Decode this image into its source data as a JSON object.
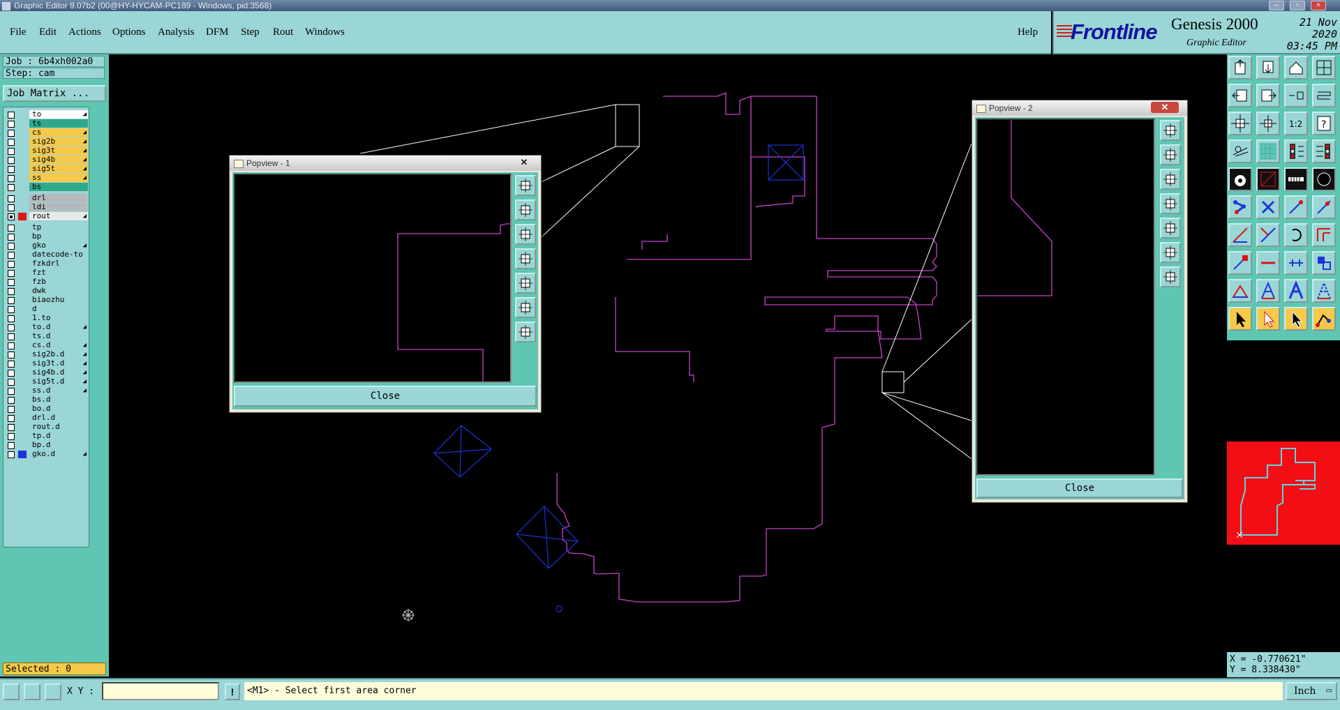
{
  "window": {
    "title": "Graphic Editor 9.07b2 (00@HY-HYCAM-PC189 - Windows, pid:3568)"
  },
  "menu": [
    {
      "label": "File"
    },
    {
      "label": "Edit"
    },
    {
      "label": "Actions"
    },
    {
      "label": "Options"
    },
    {
      "label": "Analysis"
    },
    {
      "label": "DFM"
    },
    {
      "label": "Step"
    },
    {
      "label": "Rout"
    },
    {
      "label": "Windows"
    },
    {
      "label": "Help"
    }
  ],
  "brand": {
    "logo": "Frontline",
    "product": "Genesis 2000",
    "subtitle": "Graphic Editor",
    "date": "21 Nov 2020",
    "time": "03:45 PM"
  },
  "job": {
    "label": "Job : 6b4xh002a0",
    "step": "Step: cam",
    "matrix_button": "Job Matrix ..."
  },
  "layers": [
    {
      "name": "to",
      "bg": "#ffffff",
      "mark": true
    },
    {
      "name": "ts",
      "bg": "#2fa98a"
    },
    {
      "name": "cs",
      "bg": "#f6c94a",
      "mark": true
    },
    {
      "name": "sig2b",
      "bg": "#f6c94a",
      "mark": true
    },
    {
      "name": "sig3t",
      "bg": "#f6c94a",
      "mark": true
    },
    {
      "name": "sig4b",
      "bg": "#f6c94a",
      "mark": true
    },
    {
      "name": "sig5t",
      "bg": "#f6c94a",
      "mark": true
    },
    {
      "name": "ss",
      "bg": "#f6c94a",
      "mark": true
    },
    {
      "name": "bs",
      "bg": "#2fa98a"
    },
    {
      "name": "drl",
      "bg": "#b4b9be",
      "gap": true
    },
    {
      "name": "ldi",
      "bg": "#b4b9be"
    },
    {
      "name": "rout",
      "bg": "#e9e9e9",
      "color": "#e41414",
      "checked": true,
      "mark": true
    },
    {
      "name": "tp",
      "bg": "#9ad6d6",
      "gap": true
    },
    {
      "name": "bp",
      "bg": "#9ad6d6"
    },
    {
      "name": "gko",
      "bg": "#9ad6d6",
      "mark": true
    },
    {
      "name": "datecode-to",
      "bg": "#9ad6d6"
    },
    {
      "name": "fzkdrl",
      "bg": "#9ad6d6"
    },
    {
      "name": "fzt",
      "bg": "#9ad6d6"
    },
    {
      "name": "fzb",
      "bg": "#9ad6d6"
    },
    {
      "name": "dwk",
      "bg": "#9ad6d6"
    },
    {
      "name": "biaozhu",
      "bg": "#9ad6d6"
    },
    {
      "name": "d",
      "bg": "#9ad6d6"
    },
    {
      "name": "1.to",
      "bg": "#9ad6d6"
    },
    {
      "name": "to.d",
      "bg": "#9ad6d6",
      "mark": true
    },
    {
      "name": "ts.d",
      "bg": "#9ad6d6"
    },
    {
      "name": "cs.d",
      "bg": "#9ad6d6",
      "mark": true
    },
    {
      "name": "sig2b.d",
      "bg": "#9ad6d6",
      "mark": true
    },
    {
      "name": "sig3t.d",
      "bg": "#9ad6d6",
      "mark": true
    },
    {
      "name": "sig4b.d",
      "bg": "#9ad6d6",
      "mark": true
    },
    {
      "name": "sig5t.d",
      "bg": "#9ad6d6",
      "mark": true
    },
    {
      "name": "ss.d",
      "bg": "#9ad6d6",
      "mark": true
    },
    {
      "name": "bs.d",
      "bg": "#9ad6d6"
    },
    {
      "name": "bo.d",
      "bg": "#9ad6d6"
    },
    {
      "name": "drl.d",
      "bg": "#9ad6d6"
    },
    {
      "name": "rout.d",
      "bg": "#9ad6d6"
    },
    {
      "name": "tp.d",
      "bg": "#9ad6d6"
    },
    {
      "name": "bp.d",
      "bg": "#9ad6d6"
    },
    {
      "name": "gko.d",
      "bg": "#9ad6d6",
      "color": "#1f33d9",
      "mark": true
    }
  ],
  "status": {
    "selected": "Selected : 0"
  },
  "coords": {
    "x": "X = -0.770621\"",
    "y": "Y = 8.338430\""
  },
  "bottom": {
    "xy_label": "X Y :",
    "xy_value": "",
    "prompt_icon": "!",
    "prompt": "<M1> - Select first area corner",
    "units": "Inch"
  },
  "popview1": {
    "title": "Popview - 1",
    "close": "Close"
  },
  "popview2": {
    "title": "Popview - 2",
    "close": "Close"
  },
  "colors": {
    "panel": "#9ad6d6",
    "teal": "#5fc6b3",
    "outline": "#c844c8",
    "yellow": "#f6c94a",
    "red": "#f30d14"
  },
  "tools": [
    {
      "icon": "save-up-icon"
    },
    {
      "icon": "save-down-icon"
    },
    {
      "icon": "home-icon"
    },
    {
      "icon": "window-split-icon"
    },
    {
      "icon": "pan-left-icon"
    },
    {
      "icon": "pan-right-icon"
    },
    {
      "icon": "snap-icon"
    },
    {
      "icon": "flow-icon"
    },
    {
      "icon": "zoom-fit-icon"
    },
    {
      "icon": "zoom-center-icon"
    },
    {
      "icon": "one-to-two-icon"
    },
    {
      "icon": "help-icon"
    },
    {
      "icon": "measure-icon"
    },
    {
      "icon": "grid-icon"
    },
    {
      "icon": "traffic-light-icon"
    },
    {
      "icon": "traffic-light-2-icon"
    },
    {
      "icon": "pad-icon"
    },
    {
      "icon": "line-red-icon"
    },
    {
      "icon": "ruler-icon"
    },
    {
      "icon": "circle-icon"
    },
    {
      "icon": "node-icon"
    },
    {
      "icon": "cross-node-icon"
    },
    {
      "icon": "node-red-icon"
    },
    {
      "icon": "node-red-2-icon"
    },
    {
      "icon": "draw-line-icon"
    },
    {
      "icon": "draw-diagonal-icon"
    },
    {
      "icon": "arc-icon"
    },
    {
      "icon": "pin-icon"
    },
    {
      "icon": "pad-add-icon"
    },
    {
      "icon": "line-h-icon"
    },
    {
      "icon": "line-dim-icon"
    },
    {
      "icon": "squares-icon"
    },
    {
      "icon": "triangle-icon"
    },
    {
      "icon": "a-outline-icon"
    },
    {
      "icon": "a-filled-icon"
    },
    {
      "icon": "a-dashed-icon"
    },
    {
      "icon": "cursor-icon"
    },
    {
      "icon": "cursor-red-icon"
    },
    {
      "icon": "cursor-dark-icon"
    },
    {
      "icon": "route-icon"
    }
  ]
}
